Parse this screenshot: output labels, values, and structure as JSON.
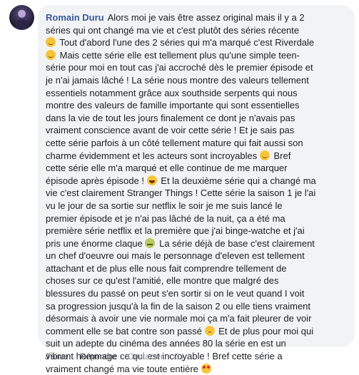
{
  "comment": {
    "author": "Romain Duru",
    "lines": [
      {
        "text": "Alors moi je vais être assez original mais il y a 2",
        "emoji": null
      },
      {
        "text": "séries qui ont changé ma vie et c'est plutôt des séries récente",
        "emoji": null
      },
      {
        "text": " Tout d'abord l'une des 2 séries qui m'a marqué c'est Riverdale",
        "emoji": "smile",
        "emoji_pos": "start"
      },
      {
        "text": " Mais cette série elle est tellement plus qu'une simple teen-",
        "emoji": "smile",
        "emoji_pos": "start"
      },
      {
        "text": "série pour moi en tout cas j'ai accroché dès le premier épisode et",
        "emoji": null
      },
      {
        "text": "je n'ai jamais lâché ! La série nous montre des valeurs tellement",
        "emoji": null
      },
      {
        "text": "essentiels notamment grâce aux southside serpents qui nous",
        "emoji": null
      },
      {
        "text": "montre des valeurs de famille importante qui sont essentielles",
        "emoji": null
      },
      {
        "text": "dans la vie de tout les jours finalement ce dont je n'avais pas",
        "emoji": null
      },
      {
        "text": "vraiment conscience avant de voir cette série ! Et je sais pas",
        "emoji": null
      },
      {
        "text": "cette série parfois à un côté tellement mature qui fait aussi son",
        "emoji": null
      },
      {
        "text": "charme évidemment et les acteurs sont incroyables ",
        "emoji": "smile",
        "emoji_pos": "end",
        "after": " Bref"
      },
      {
        "text": "cette série elle m'a marqué et elle continue de me marquer",
        "emoji": null
      },
      {
        "text": "épisode après épisode ! ",
        "emoji": "grin",
        "emoji_pos": "end",
        "after": " Et la deuxième série qui a changé ma"
      },
      {
        "text": "vie c'est clairement Stranger Things ! Cette série la saison 1 je l'ai",
        "emoji": null
      },
      {
        "text": "vu le jour de sa sortie sur netflix le soir je me suis lancé le",
        "emoji": null
      },
      {
        "text": "premier épisode et je n'ai pas lâché de la nuit, ça a été ma",
        "emoji": null
      },
      {
        "text": "première série netflix et la première que j'ai binge-watche et j'ai",
        "emoji": null
      },
      {
        "text": "pris une énorme claque ",
        "emoji": "sick",
        "emoji_pos": "end",
        "after": " La série déjà de base c'est clairement"
      },
      {
        "text": "un chef d'oeuvre oui mais le personnage d'eleven est tellement",
        "emoji": null
      },
      {
        "text": "attachant et de plus elle nous fait comprendre tellement de",
        "emoji": null
      },
      {
        "text": "choses sur ce qu'est l'amitié, elle montre que malgré des",
        "emoji": null
      },
      {
        "text": "blessures du passé on peut s'en sortir si on le veut quand I voit",
        "emoji": null
      },
      {
        "text": "sa progression jusqu'à la fin de la saison 2 ou elle tiens vraiment",
        "emoji": null
      },
      {
        "text": "désormais à avoir une vie normale moi ça m'a fait pleurer de voir",
        "emoji": null
      },
      {
        "text": "comment elle se bat contre son passé ",
        "emoji": "sad",
        "emoji_pos": "end",
        "after": " Et de plus pour moi qui"
      },
      {
        "text": "suit un adepte du cinéma des années 80 la série en est un",
        "emoji": null
      },
      {
        "text": "vibrant hommage ce qui est incroyable ! Bref cette série a",
        "emoji": null
      },
      {
        "text": "vraiment changé ma vie toute entière ",
        "emoji": "heart-eyes",
        "emoji_pos": "end"
      }
    ]
  },
  "actions": {
    "like": "J'aime",
    "reply": "Répondre",
    "contact": "Contacter",
    "time": "5 j",
    "separator": "·"
  },
  "colors": {
    "author": "#385898",
    "bubble": "#f2f3f5",
    "text": "#1c1e21",
    "meta": "#90949c"
  }
}
